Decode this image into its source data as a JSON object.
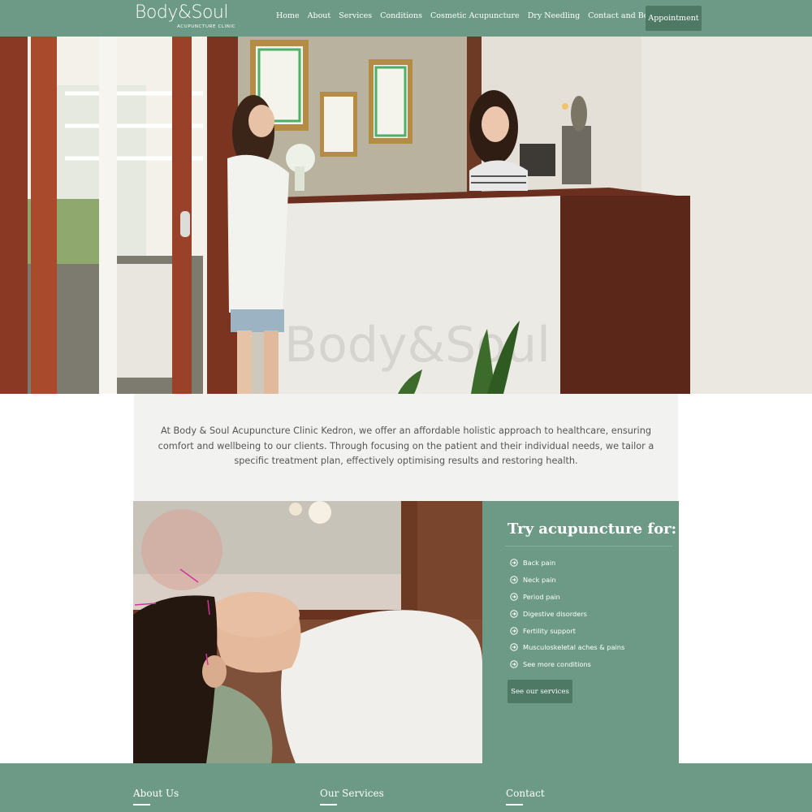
{
  "header": {
    "logo_main": "Body&Soul",
    "logo_sub": "ACUPUNCTURE CLINIC",
    "nav": [
      "Home",
      "About",
      "Services",
      "Conditions",
      "Cosmetic Acupuncture",
      "Dry Needling",
      "Contact and Bookings"
    ],
    "appointment_label": "Appointment"
  },
  "intro": {
    "text": "At Body & Soul Acupuncture Clinic Kedron, we offer an affordable holistic approach to healthcare, ensuring comfort and wellbeing to our clients. Through focusing on the patient and their individual needs, we tailor a specific treatment plan, effectively optimising results and restoring health."
  },
  "feature": {
    "title": "Try acupuncture for:",
    "conditions": [
      "Back pain",
      "Neck pain",
      "Period pain",
      "Digestive disorders",
      "Fertility support",
      "Musculoskeletal aches & pains",
      "See more conditions"
    ],
    "button_label": "See our services"
  },
  "footer": {
    "columns": [
      "About Us",
      "Our Services",
      "Contact"
    ]
  },
  "colors": {
    "brand_green": "#6c9a86",
    "button_green": "#4e7a65",
    "intro_bg": "#f2f3f1"
  }
}
